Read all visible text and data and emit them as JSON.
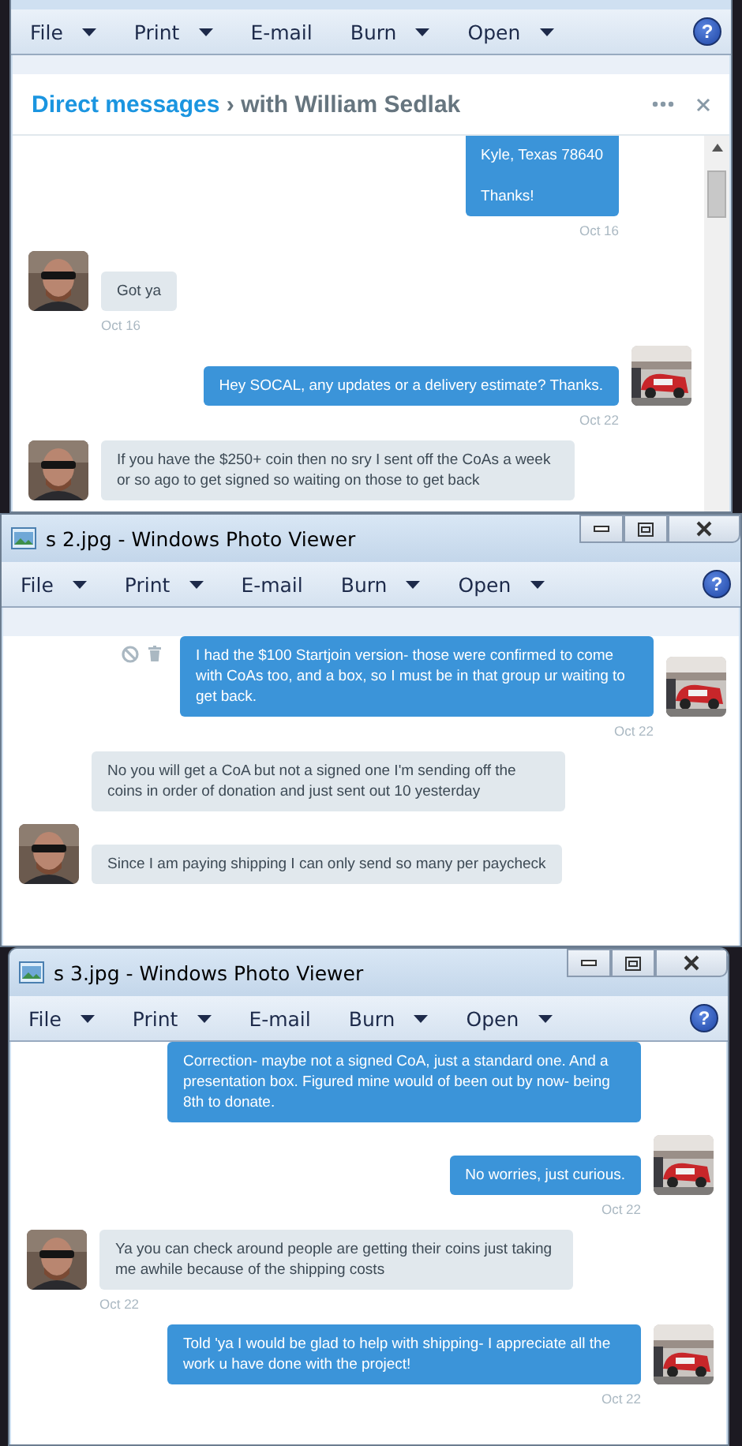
{
  "windows": [
    {
      "scrollbar": true,
      "help": "?",
      "toolbar": [
        {
          "label": "File",
          "dropdown": true
        },
        {
          "label": "Print",
          "dropdown": true
        },
        {
          "label": "E-mail",
          "dropdown": false
        },
        {
          "label": "Burn",
          "dropdown": true
        },
        {
          "label": "Open",
          "dropdown": true
        }
      ],
      "header": {
        "section": "Direct messages",
        "separator": "›",
        "conversation": "with William Sedlak"
      },
      "messages": [
        {
          "kind": "sent",
          "paragraphs": [
            "Kyle, Texas 78640",
            "Thanks!"
          ],
          "time": "Oct 16",
          "avatar": false,
          "actions": false
        },
        {
          "kind": "received",
          "paragraphs": [
            "Got ya"
          ],
          "time": "Oct 16",
          "avatar": true,
          "actions": false
        },
        {
          "kind": "sent",
          "paragraphs": [
            "Hey SOCAL, any updates or a delivery estimate? Thanks."
          ],
          "time": "Oct 22",
          "avatar": true,
          "actions": false
        },
        {
          "kind": "received",
          "paragraphs": [
            "If you have the $250+ coin then no sry I sent off the CoAs a week or so ago to get signed so waiting on those to get back"
          ],
          "avatar": true,
          "actions": false
        }
      ]
    },
    {
      "title": "s 2.jpg - Windows Photo Viewer",
      "scrollbar": false,
      "help": "?",
      "toolbar": [
        {
          "label": "File",
          "dropdown": true
        },
        {
          "label": "Print",
          "dropdown": true
        },
        {
          "label": "E-mail",
          "dropdown": false
        },
        {
          "label": "Burn",
          "dropdown": true
        },
        {
          "label": "Open",
          "dropdown": true
        }
      ],
      "messages": [
        {
          "kind": "sent",
          "paragraphs": [
            "I had the $100 Startjoin version- those were confirmed to come with CoAs too, and a box, so I must be in that group ur waiting to get back."
          ],
          "time": "Oct 22",
          "avatar": true,
          "actions": true
        },
        {
          "kind": "received",
          "paragraphs": [
            "No you will get a CoA but not a signed one I'm sending off the coins in order of donation and just sent out 10 yesterday"
          ],
          "avatar": false,
          "actions": false
        },
        {
          "kind": "received",
          "paragraphs": [
            "Since I am paying shipping I can only send so many per paycheck"
          ],
          "avatar": true,
          "actions": false
        }
      ]
    },
    {
      "title": "s 3.jpg - Windows Photo Viewer",
      "scrollbar": false,
      "help": "?",
      "toolbar": [
        {
          "label": "File",
          "dropdown": true
        },
        {
          "label": "Print",
          "dropdown": true
        },
        {
          "label": "E-mail",
          "dropdown": false
        },
        {
          "label": "Burn",
          "dropdown": true
        },
        {
          "label": "Open",
          "dropdown": true
        }
      ],
      "messages": [
        {
          "kind": "sent",
          "paragraphs": [
            "Correction- maybe not a signed CoA, just a standard one. And a presentation box. Figured mine would of been out by now- being 8th to donate."
          ],
          "avatar": false,
          "actions": false
        },
        {
          "kind": "sent",
          "paragraphs": [
            "No worries, just curious."
          ],
          "time": "Oct 22",
          "avatar": true,
          "actions": false
        },
        {
          "kind": "received",
          "paragraphs": [
            "Ya you can check around people are getting their coins just taking me awhile because of the shipping costs"
          ],
          "time": "Oct 22",
          "avatar": true,
          "actions": false
        },
        {
          "kind": "sent",
          "paragraphs": [
            "Told 'ya I would be glad to help with shipping- I appreciate all the work u have done with the project!"
          ],
          "time": "Oct 22",
          "avatar": true,
          "actions": false
        }
      ]
    }
  ]
}
